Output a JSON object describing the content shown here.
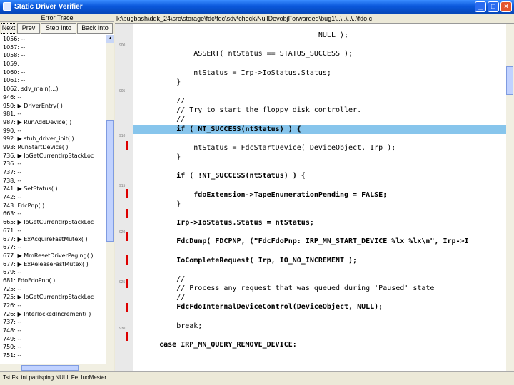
{
  "window": {
    "title": "Static Driver Verifier",
    "minimize": "_",
    "maximize": "□",
    "close": "×"
  },
  "trace": {
    "header": "Error Trace",
    "buttons": [
      "Next",
      "Prev",
      "Step Into",
      "Back Into"
    ],
    "rows": [
      {
        "num": "1056:",
        "text": "--"
      },
      {
        "num": "1057:",
        "text": "--"
      },
      {
        "num": "1058:",
        "text": "--"
      },
      {
        "num": "1059:",
        "text": ""
      },
      {
        "num": "1060:",
        "text": "--"
      },
      {
        "num": "1061:",
        "text": "--"
      },
      {
        "num": "1062:",
        "text": "sdv_main(...)"
      },
      {
        "num": "946:",
        "text": "--"
      },
      {
        "num": "950:",
        "text": "▶ DriverEntry( )"
      },
      {
        "num": "981:",
        "text": "--"
      },
      {
        "num": "987:",
        "text": "▶ RunAddDevice( )"
      },
      {
        "num": "990:",
        "text": "--"
      },
      {
        "num": "992:",
        "text": "▶ stub_driver_init( )"
      },
      {
        "num": "993:",
        "text": "RunStartDevice( )"
      },
      {
        "num": "736:",
        "text": "▶ IoGetCurrentIrpStackLoc"
      },
      {
        "num": "736:",
        "text": "--"
      },
      {
        "num": "737:",
        "text": "--"
      },
      {
        "num": "738:",
        "text": "--"
      },
      {
        "num": "741:",
        "text": "▶ SetStatus( )"
      },
      {
        "num": "742:",
        "text": "--"
      },
      {
        "num": "743:",
        "text": "FdcPnp( )"
      },
      {
        "num": "663:",
        "text": "--"
      },
      {
        "num": "665:",
        "text": "▶ IoGetCurrentIrpStackLoc"
      },
      {
        "num": "671:",
        "text": "--"
      },
      {
        "num": "677:",
        "text": "▶ ExAcquireFastMutex( )"
      },
      {
        "num": "677:",
        "text": "--"
      },
      {
        "num": "677:",
        "text": "▶ MmResetDriverPaging( )"
      },
      {
        "num": "677:",
        "text": "▶ ExReleaseFastMutex( )"
      },
      {
        "num": "679:",
        "text": "--"
      },
      {
        "num": "681:",
        "text": "FdoFdoPnp( )"
      },
      {
        "num": "725:",
        "text": "--"
      },
      {
        "num": "725:",
        "text": "▶ IoGetCurrentIrpStackLoc"
      },
      {
        "num": "726:",
        "text": "--"
      },
      {
        "num": "726:",
        "text": "▶ InterlockedIncrement( )"
      },
      {
        "num": "737:",
        "text": "--"
      },
      {
        "num": "748:",
        "text": "--"
      },
      {
        "num": "749:",
        "text": "--"
      },
      {
        "num": "750:",
        "text": "--"
      },
      {
        "num": "751:",
        "text": "--"
      }
    ]
  },
  "path": "k:\\bugbash\\ddk_24\\src\\storage\\fdc\\fdc\\sdv\\check\\NullDevobjForwarded\\bug1\\..\\..\\..\\..\\fdo.c",
  "gutter_numbers": [
    "900",
    "905",
    "910",
    "915",
    "920",
    "925",
    "930"
  ],
  "code_lines": [
    "                                           NULL );",
    "",
    "              ASSERT( ntStatus == STATUS_SUCCESS );",
    "",
    "              ntStatus = Irp->IoStatus.Status;",
    "          }",
    "",
    "          //",
    "          // Try to start the floppy disk controller.",
    "          //",
    "          if ( NT_SUCCESS(ntStatus) ) {",
    "",
    "              ntStatus = FdcStartDevice( DeviceObject, Irp );",
    "          }",
    "",
    "          if ( !NT_SUCCESS(ntStatus) ) {",
    "",
    "              fdoExtension->TapeEnumerationPending = FALSE;",
    "          }",
    "",
    "          Irp->IoStatus.Status = ntStatus;",
    "",
    "          FdcDump( FDCPNP, (\"FdcFdoPnp: IRP_MN_START_DEVICE %lx %lx\\n\", Irp->I",
    "",
    "          IoCompleteRequest( Irp, IO_NO_INCREMENT );",
    "",
    "          //",
    "          // Process any request that was queued during 'Paused' state",
    "          //",
    "          FdcFdoInternalDeviceControl(DeviceObject, NULL);",
    "",
    "          break;",
    "",
    "      case IRP_MN_QUERY_REMOVE_DEVICE:"
  ],
  "status": "Tst Fst int partisping NULL Fe, IuoMester"
}
